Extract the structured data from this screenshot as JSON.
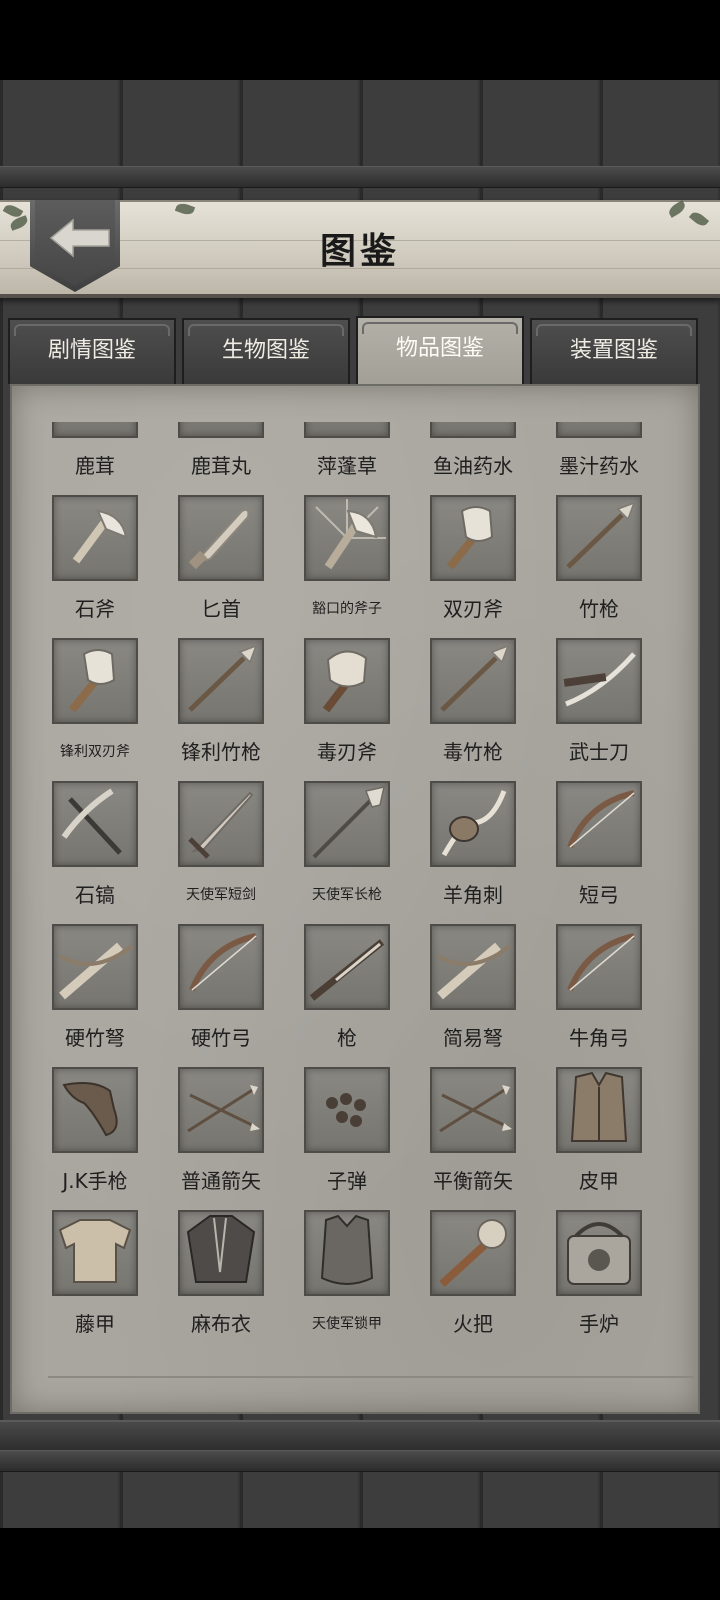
{
  "header": {
    "title": "图鉴"
  },
  "tabs": [
    {
      "label": "剧情图鉴",
      "active": false
    },
    {
      "label": "生物图鉴",
      "active": false
    },
    {
      "label": "物品图鉴",
      "active": true
    },
    {
      "label": "装置图鉴",
      "active": false
    }
  ],
  "items": [
    [
      {
        "name": "鹿茸",
        "icon": "antler-icon"
      },
      {
        "name": "鹿茸丸",
        "icon": "pill-icon"
      },
      {
        "name": "萍蓬草",
        "icon": "herb-icon"
      },
      {
        "name": "鱼油药水",
        "icon": "bottle-icon"
      },
      {
        "name": "墨汁药水",
        "icon": "bottle-icon"
      }
    ],
    [
      {
        "name": "石斧",
        "icon": "axe-icon"
      },
      {
        "name": "匕首",
        "icon": "dagger-icon"
      },
      {
        "name": "豁口的斧子",
        "icon": "chipped-axe-icon",
        "small": true
      },
      {
        "name": "双刃斧",
        "icon": "double-axe-icon"
      },
      {
        "name": "竹枪",
        "icon": "spear-icon"
      }
    ],
    [
      {
        "name": "锋利双刃斧",
        "icon": "double-axe-icon",
        "small": true
      },
      {
        "name": "锋利竹枪",
        "icon": "spear-icon"
      },
      {
        "name": "毒刃斧",
        "icon": "poison-axe-icon"
      },
      {
        "name": "毒竹枪",
        "icon": "spear-icon"
      },
      {
        "name": "武士刀",
        "icon": "katana-icon"
      }
    ],
    [
      {
        "name": "石镐",
        "icon": "pickaxe-icon"
      },
      {
        "name": "天使军短剑",
        "icon": "sword-icon",
        "small": true
      },
      {
        "name": "天使军长枪",
        "icon": "lance-icon",
        "small": true
      },
      {
        "name": "羊角刺",
        "icon": "horn-blade-icon"
      },
      {
        "name": "短弓",
        "icon": "bow-icon"
      }
    ],
    [
      {
        "name": "硬竹弩",
        "icon": "crossbow-icon"
      },
      {
        "name": "硬竹弓",
        "icon": "bow-icon"
      },
      {
        "name": "枪",
        "icon": "musket-icon"
      },
      {
        "name": "简易弩",
        "icon": "crossbow-icon"
      },
      {
        "name": "牛角弓",
        "icon": "bow-icon"
      }
    ],
    [
      {
        "name": "J.K手枪",
        "icon": "pistol-icon"
      },
      {
        "name": "普通箭矢",
        "icon": "arrows-icon"
      },
      {
        "name": "子弹",
        "icon": "bullets-icon"
      },
      {
        "name": "平衡箭矢",
        "icon": "arrows-icon"
      },
      {
        "name": "皮甲",
        "icon": "vest-icon"
      }
    ],
    [
      {
        "name": "藤甲",
        "icon": "rattan-armor-icon"
      },
      {
        "name": "麻布衣",
        "icon": "cloth-icon"
      },
      {
        "name": "天使军锁甲",
        "icon": "chainmail-icon",
        "small": true
      },
      {
        "name": "火把",
        "icon": "torch-icon"
      },
      {
        "name": "手炉",
        "icon": "hand-warmer-icon"
      }
    ]
  ]
}
